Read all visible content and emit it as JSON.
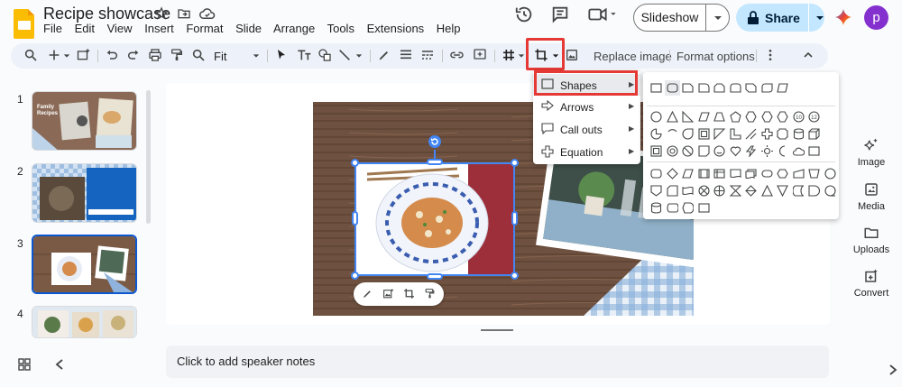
{
  "app": {
    "doc_title": "Recipe showcase",
    "menus": [
      "File",
      "Edit",
      "View",
      "Insert",
      "Format",
      "Slide",
      "Arrange",
      "Tools",
      "Extensions",
      "Help"
    ],
    "avatar_letter": "p"
  },
  "header": {
    "slideshow_label": "Slideshow",
    "share_label": "Share"
  },
  "toolbar": {
    "zoom_value": "Fit",
    "replace_image_label": "Replace image",
    "format_options_label": "Format options"
  },
  "filmstrip": {
    "slides": [
      {
        "number": "1",
        "title": "Family Recipes"
      },
      {
        "number": "2"
      },
      {
        "number": "3",
        "selected": true
      },
      {
        "number": "4"
      }
    ]
  },
  "mask_menu": {
    "items": [
      {
        "label": "Shapes",
        "icon": "square-icon",
        "highlighted": true
      },
      {
        "label": "Arrows",
        "icon": "arrow-icon"
      },
      {
        "label": "Call outs",
        "icon": "callout-icon"
      },
      {
        "label": "Equation",
        "icon": "plus-icon"
      }
    ]
  },
  "notes": {
    "placeholder": "Click to add speaker notes"
  },
  "side_panel": {
    "items": [
      {
        "label": "Image",
        "icon": "image-sparkle-icon"
      },
      {
        "label": "Media",
        "icon": "media-icon"
      },
      {
        "label": "Uploads",
        "icon": "folder-icon"
      },
      {
        "label": "Convert",
        "icon": "convert-icon"
      }
    ]
  },
  "colors": {
    "accent": "#0b57d0",
    "highlight_red": "#e53935",
    "share_bg": "#c2e7ff",
    "avatar_bg": "#8430ce",
    "logo": "#fbbc04"
  }
}
